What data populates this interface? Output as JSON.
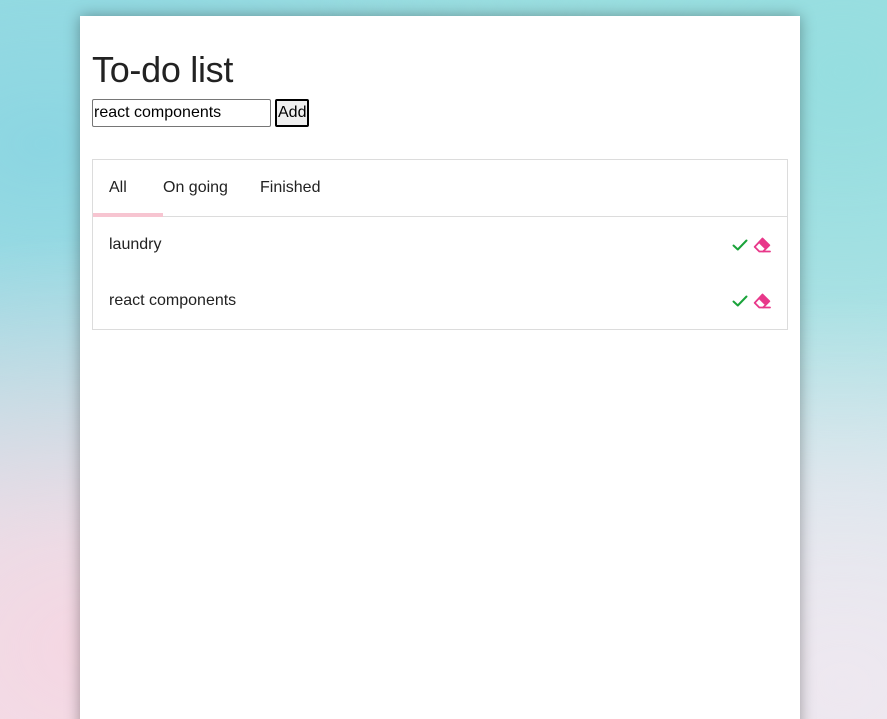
{
  "header": {
    "title": "To-do list"
  },
  "add_form": {
    "input_value": "react components",
    "add_label": "Add"
  },
  "tabs": [
    {
      "label": "All",
      "active": true
    },
    {
      "label": "On going",
      "active": false
    },
    {
      "label": "Finished",
      "active": false
    }
  ],
  "todos": [
    {
      "text": "laundry"
    },
    {
      "text": "react components"
    }
  ],
  "colors": {
    "check": "#1aa33a",
    "erase": "#e8388a",
    "active_tab_indicator": "#f7c5d1"
  },
  "icons": {
    "complete": "check-icon",
    "delete": "eraser-icon"
  }
}
